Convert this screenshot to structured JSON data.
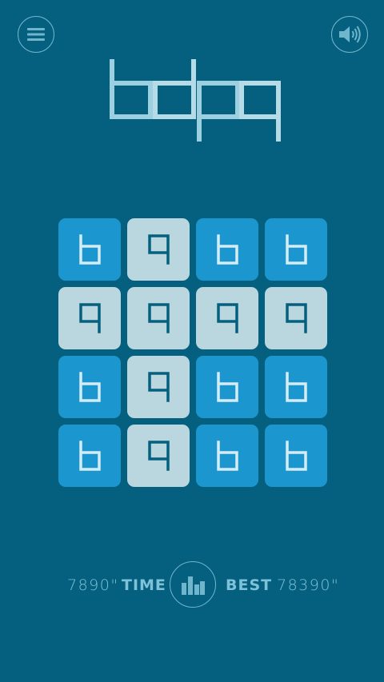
{
  "title": "bdpq",
  "colors": {
    "background": "#05607f",
    "tile_blue": "#1b96cf",
    "tile_light": "#bad6df",
    "glyph_on_blue": "#d4ecf4",
    "glyph_on_light": "#05607f",
    "accent_text": "#7dc2d8"
  },
  "header": {
    "menu_icon": "hamburger-menu-icon",
    "sound_icon": "speaker-volume-icon"
  },
  "grid": {
    "rows": [
      [
        {
          "letter": "b",
          "style": "blue"
        },
        {
          "letter": "q",
          "style": "light"
        },
        {
          "letter": "b",
          "style": "blue"
        },
        {
          "letter": "b",
          "style": "blue"
        }
      ],
      [
        {
          "letter": "q",
          "style": "light"
        },
        {
          "letter": "q",
          "style": "light"
        },
        {
          "letter": "q",
          "style": "light"
        },
        {
          "letter": "q",
          "style": "light"
        }
      ],
      [
        {
          "letter": "b",
          "style": "blue"
        },
        {
          "letter": "q",
          "style": "light"
        },
        {
          "letter": "b",
          "style": "blue"
        },
        {
          "letter": "b",
          "style": "blue"
        }
      ],
      [
        {
          "letter": "b",
          "style": "blue"
        },
        {
          "letter": "q",
          "style": "light"
        },
        {
          "letter": "b",
          "style": "blue"
        },
        {
          "letter": "b",
          "style": "blue"
        }
      ]
    ]
  },
  "footer": {
    "time_value": "7890\"",
    "time_label": "TIME",
    "best_label": "BEST",
    "best_value": "78390\"",
    "stats_icon": "bar-chart-icon"
  }
}
